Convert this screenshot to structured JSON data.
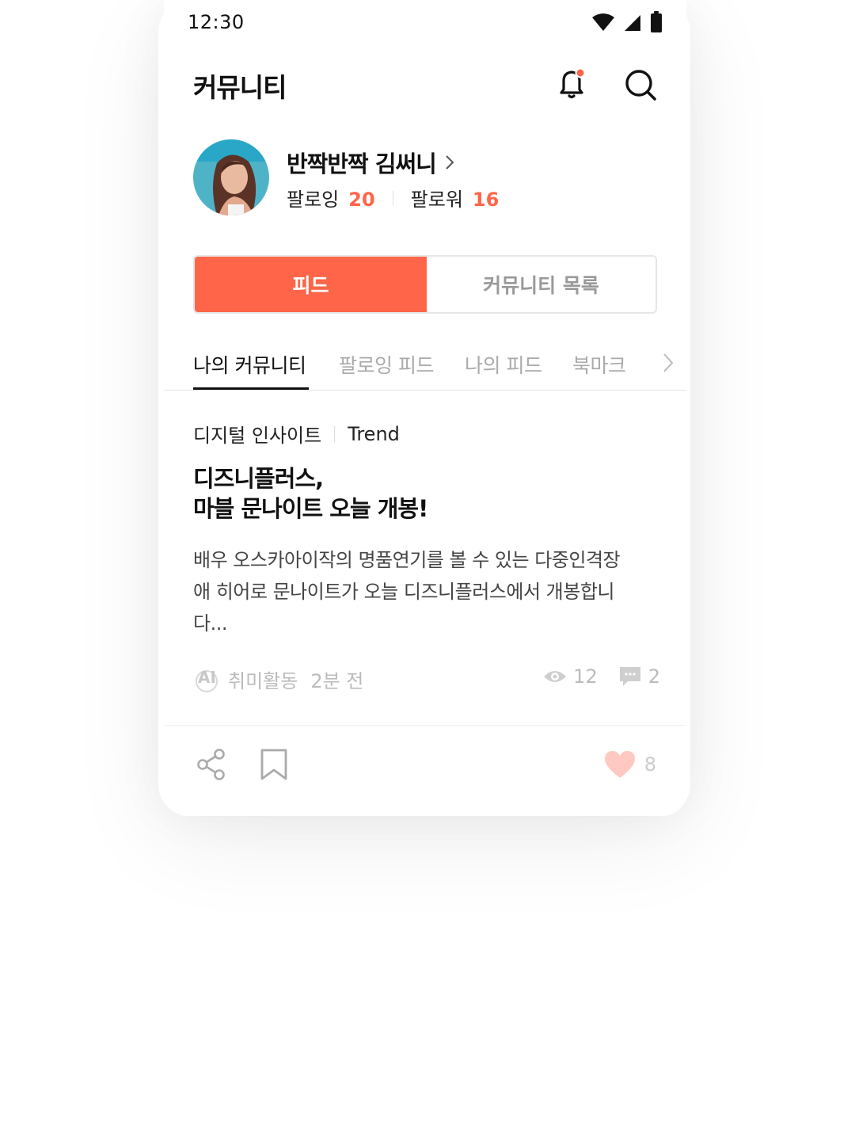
{
  "status_bar": {
    "time": "12:30"
  },
  "header": {
    "title": "커뮤니티"
  },
  "profile": {
    "nickname": "반짝반짝 김써니",
    "following_label": "팔로잉",
    "following_count": "20",
    "follower_label": "팔로워",
    "follower_count": "16"
  },
  "segment": {
    "tabs": [
      {
        "label": "피드",
        "active": true
      },
      {
        "label": "커뮤니티 목록",
        "active": false
      }
    ]
  },
  "subtabs": [
    {
      "label": "나의 커뮤니티",
      "active": true
    },
    {
      "label": "팔로잉 피드",
      "active": false
    },
    {
      "label": "나의 피드",
      "active": false
    },
    {
      "label": "북마크",
      "active": false
    }
  ],
  "post": {
    "category": "디지털 인사이트",
    "tag": "Trend",
    "title_line1": "디즈니플러스,",
    "title_line2": "마블 문나이트 오늘 개봉!",
    "body_line1": "배우 오스카아이작의 명품연기를 볼 수 있는 다중인격장",
    "body_line2": "애 히어로 문나이트가 오늘 디즈니플러스에서 개봉합니",
    "body_line3": "다...",
    "author_badge": "AI",
    "author": "취미활동",
    "time_ago": "2분 전",
    "views": "12",
    "comments": "2",
    "likes": "8"
  },
  "colors": {
    "accent": "#ff6549",
    "text": "#111111",
    "muted": "#aaaaaa",
    "border": "#e6e6e6",
    "like": "#ffc9c2"
  },
  "icons": [
    "wifi-icon",
    "signal-icon",
    "battery-icon",
    "bell-icon",
    "search-icon",
    "chevron-right-icon",
    "eye-icon",
    "comment-icon",
    "share-icon",
    "bookmark-icon",
    "heart-icon"
  ]
}
